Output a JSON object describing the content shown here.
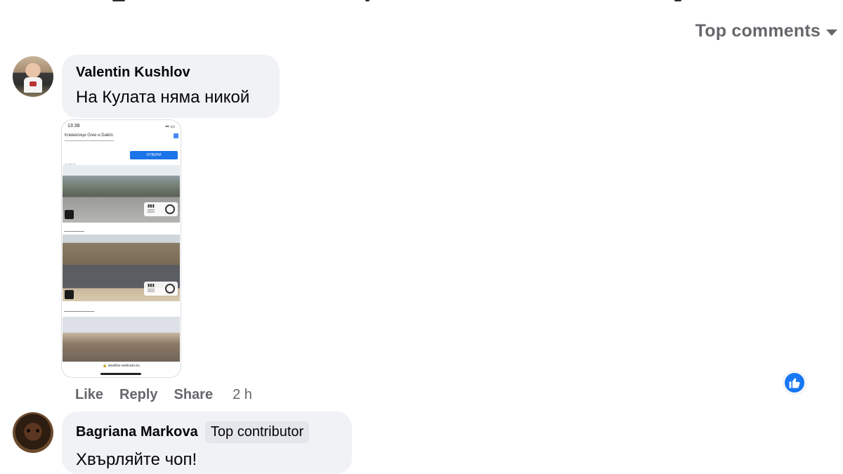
{
  "sort": {
    "label": "Top comments",
    "icon": "caret-down-icon"
  },
  "comments": [
    {
      "author": "Valentin Kushlov",
      "text": "На Кулата няма никой",
      "attachment": {
        "status_time": "13:38",
        "ad_title": "Климатици Gree и Daikin",
        "ad_button": "ОТВОРИ",
        "url": "🔒 weather-webcam.eu"
      },
      "actions": [
        "Like",
        "Reply",
        "Share"
      ],
      "time": "2 h",
      "reaction_icon": "like-reaction-icon"
    },
    {
      "author": "Bagriana Markova",
      "badge": "Top contributor",
      "text": "Хвърляйте чоп!"
    }
  ],
  "colors": {
    "bubble": "#f0f2f5",
    "secondary_text": "#65676b",
    "like_blue": "#1877f2"
  }
}
